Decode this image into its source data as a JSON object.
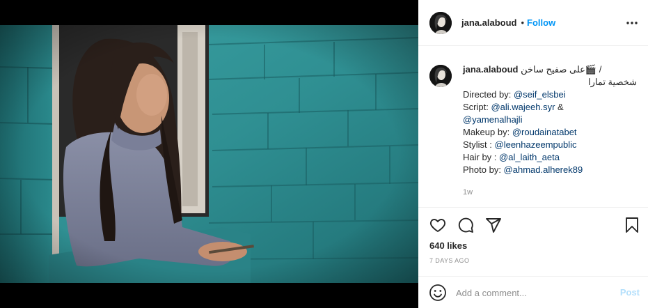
{
  "post": {
    "username": "jana.alaboud",
    "dot": "•",
    "follow_label": "Follow",
    "more_icon": "more-horizontal-icon"
  },
  "caption": {
    "username": "jana.alaboud",
    "first_line": "/ 🎬على صفيح ساخن",
    "second_line": "شخصية تمارا",
    "credits": [
      {
        "label": "Directed by: ",
        "mention": "@seif_elsbei"
      },
      {
        "label": "Script: ",
        "mention": "@ali.wajeeh.syr",
        "suffix": " &"
      },
      {
        "label": "",
        "mention": "@yamenalhajli"
      },
      {
        "label": "Makeup by: ",
        "mention": "@roudainatabet"
      },
      {
        "label": "Stylist : ",
        "mention": "@leenhazeempublic"
      },
      {
        "label": "Hair by : ",
        "mention": "@al_laith_aeta"
      },
      {
        "label": "Photo by: ",
        "mention": "@ahmad.alherek89"
      }
    ],
    "time": "1w"
  },
  "actions": {
    "like_icon": "heart-icon",
    "comment_icon": "comment-icon",
    "share_icon": "share-icon",
    "save_icon": "bookmark-icon"
  },
  "likes": "640 likes",
  "posted_ago": "7 DAYS AGO",
  "comment": {
    "placeholder": "Add a comment...",
    "post_label": "Post",
    "emoji_icon": "smiley-icon"
  },
  "colors": {
    "link": "#0095f6",
    "mention": "#00376b",
    "muted": "#8e8e8e",
    "post_disabled": "#b2dffc",
    "wall": "#2f8f92"
  }
}
